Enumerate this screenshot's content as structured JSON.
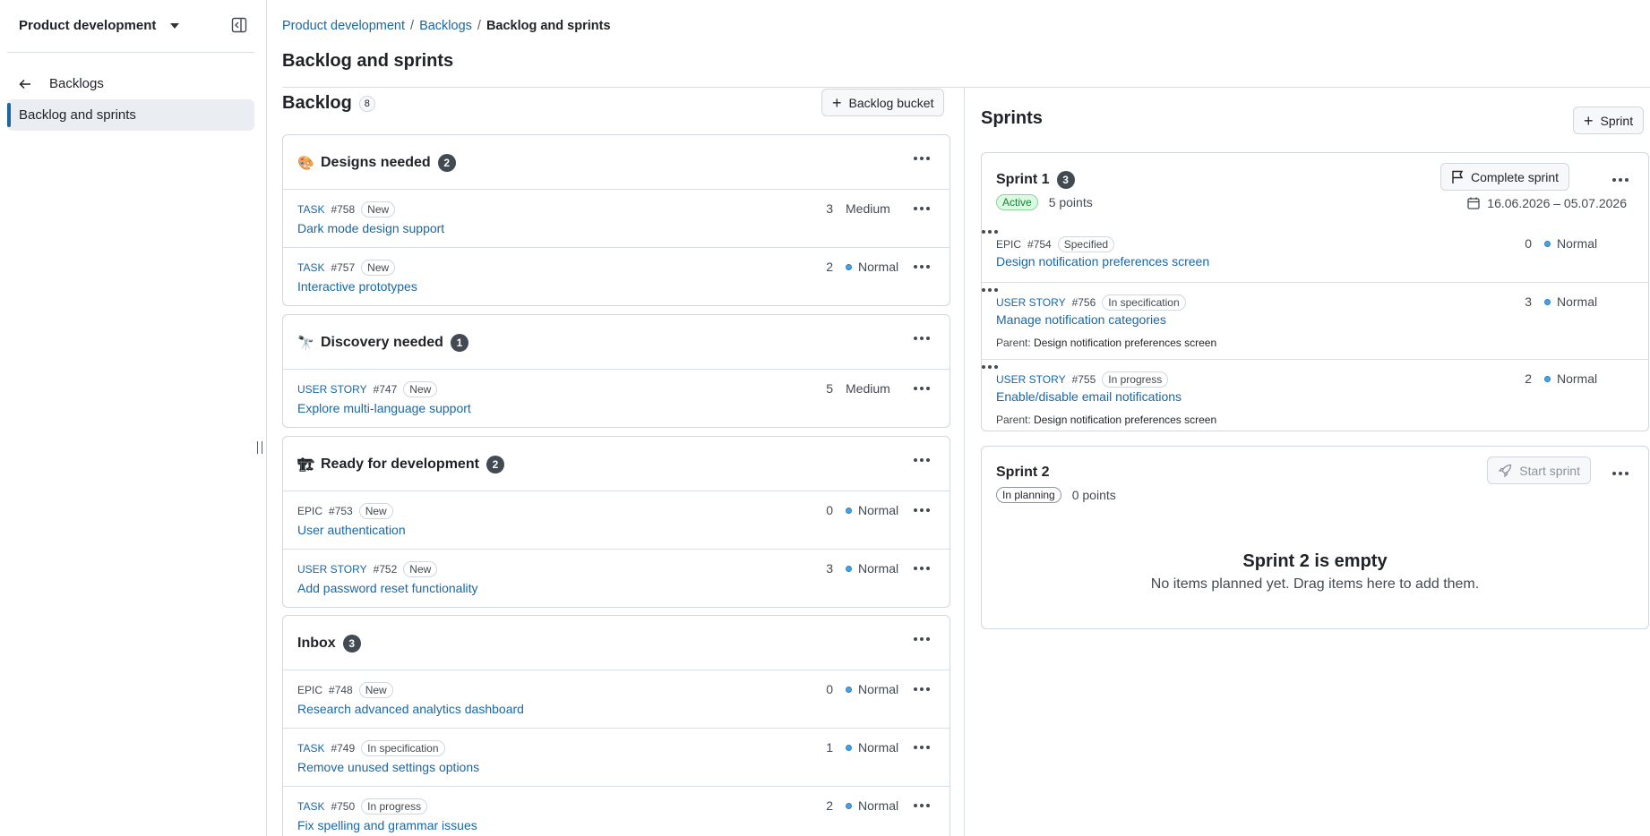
{
  "sidebar": {
    "project": "Product development",
    "back_label": "Backlogs",
    "active_item": "Backlog and sprints"
  },
  "breadcrumb": [
    "Product development",
    "Backlogs",
    "Backlog and sprints"
  ],
  "page_title": "Backlog and sprints",
  "backlog": {
    "title": "Backlog",
    "count": "8",
    "add_bucket_label": "Backlog bucket",
    "buckets": [
      {
        "emoji": "🎨",
        "name": "Designs needed",
        "count": "2",
        "items": [
          {
            "type": "TASK",
            "id": "#758",
            "status": "New",
            "title": "Dark mode design support",
            "points": "3",
            "priority": "Medium"
          },
          {
            "type": "TASK",
            "id": "#757",
            "status": "New",
            "title": "Interactive prototypes",
            "points": "2",
            "priority": "Normal"
          }
        ]
      },
      {
        "emoji": "🔭",
        "name": "Discovery needed",
        "count": "1",
        "items": [
          {
            "type": "USER STORY",
            "id": "#747",
            "status": "New",
            "title": "Explore multi-language support",
            "points": "5",
            "priority": "Medium"
          }
        ]
      },
      {
        "emoji": "🏗",
        "name": "Ready for development",
        "count": "2",
        "items": [
          {
            "type": "EPIC",
            "id": "#753",
            "status": "New",
            "title": "User authentication",
            "points": "0",
            "priority": "Normal"
          },
          {
            "type": "USER STORY",
            "id": "#752",
            "status": "New",
            "title": "Add password reset functionality",
            "points": "3",
            "priority": "Normal"
          }
        ]
      },
      {
        "emoji": "",
        "name": "Inbox",
        "count": "3",
        "items": [
          {
            "type": "EPIC",
            "id": "#748",
            "status": "New",
            "title": "Research advanced analytics dashboard",
            "points": "0",
            "priority": "Normal"
          },
          {
            "type": "TASK",
            "id": "#749",
            "status": "In specification",
            "title": "Remove unused settings options",
            "points": "1",
            "priority": "Normal"
          },
          {
            "type": "TASK",
            "id": "#750",
            "status": "In progress",
            "title": "Fix spelling and grammar issues",
            "points": "2",
            "priority": "Normal"
          }
        ]
      }
    ]
  },
  "sprints": {
    "title": "Sprints",
    "add_sprint_label": "Sprint",
    "sprint1": {
      "name": "Sprint 1",
      "count": "3",
      "status": "Active",
      "points": "5 points",
      "action": "Complete sprint",
      "dates": "16.06.2026 – 05.07.2026",
      "parent_label": "Parent:",
      "items": [
        {
          "type": "EPIC",
          "id": "#754",
          "status": "Specified",
          "title": "Design notification preferences screen",
          "points": "0",
          "priority": "Normal",
          "parent": ""
        },
        {
          "type": "USER STORY",
          "id": "#756",
          "status": "In specification",
          "title": "Manage notification categories",
          "points": "3",
          "priority": "Normal",
          "parent": "Design notification preferences screen"
        },
        {
          "type": "USER STORY",
          "id": "#755",
          "status": "In progress",
          "title": "Enable/disable email notifications",
          "points": "2",
          "priority": "Normal",
          "parent": "Design notification preferences screen"
        }
      ]
    },
    "sprint2": {
      "name": "Sprint 2",
      "status": "In planning",
      "points": "0 points",
      "action": "Start sprint",
      "empty_title": "Sprint 2 is empty",
      "empty_desc": "No items planned yet. Drag items here to add them."
    }
  },
  "colors": {
    "link": "#1a67a3",
    "active_green": "#1a7f37",
    "count_bg": "#424a53"
  }
}
